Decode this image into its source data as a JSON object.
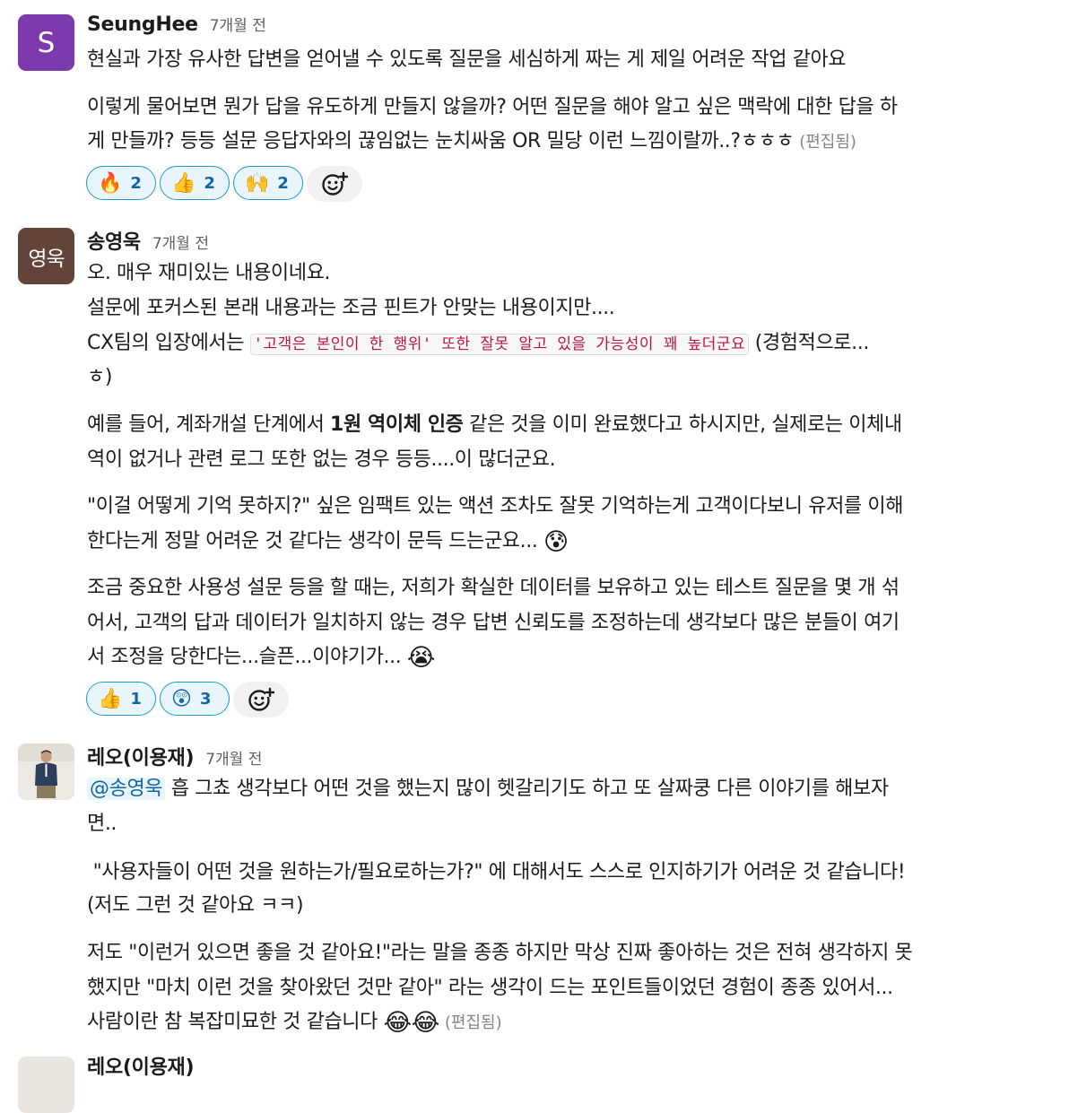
{
  "messages": [
    {
      "author": "SeungHee",
      "avatar_text": "S",
      "time": "7개월 전",
      "lines": [
        "현실과 가장 유사한 답변을 얻어낼 수 있도록 질문을 세심하게 짜는 게 제일 어려운 작업 같아요",
        "이렇게 물어보면 뭔가 답을 유도하게 만들지 않을까? 어떤 질문을 해야 알고 싶은 맥락에 대한 답을 하",
        "게 만들까? 등등 설문 응답자와의 끊임없는 눈치싸움 OR 밀당 이런 느낌이랄까..?ㅎㅎㅎ"
      ],
      "edited": "(편집됨)",
      "reactions": [
        {
          "emoji": "🔥",
          "count": "2"
        },
        {
          "emoji": "👍",
          "count": "2"
        },
        {
          "emoji": "🙌",
          "count": "2"
        }
      ]
    },
    {
      "author": "송영욱",
      "avatar_text": "영욱",
      "time": "7개월 전",
      "lines": {
        "l1": "오. 매우 재미있는 내용이네요.",
        "l2": "설문에 포커스된 본래 내용과는 조금 핀트가 안맞는 내용이지만....",
        "l3_pre": "CX팀의 입장에서는 ",
        "l3_code": "'고객은 본인이 한 행위' 또한 잘못 알고 있을 가능성이 꽤 높더군요",
        "l3_post": " (경험적으로...",
        "l4": "ㅎ)",
        "l5_pre": "예를 들어, 계좌개설 단계에서 ",
        "l5_bold": "1원 역이체 인증",
        "l5_post": " 같은 것을 이미 완료했다고 하시지만, 실제로는 이체내",
        "l6": "역이 없거나 관련 로그 또한 없는 경우 등등....이 많더군요.",
        "l7": "\"이걸 어떻게 기억 못하지?\" 싶은 임팩트 있는 액션 조차도 잘못 기억하는게 고객이다보니 유저를 이해",
        "l8": "한다는게 정말 어려운 것 같다는 생각이 문득 드는군요...",
        "l8_emoji": "😰",
        "l9": "조금 중요한 사용성 설문 등을 할 때는, 저희가 확실한 데이터를 보유하고 있는 테스트 질문을 몇 개 섞",
        "l10": "어서, 고객의 답과 데이터가 일치하지 않는 경우 답변 신뢰도를 조정하는데 생각보다 많은 분들이 여기",
        "l11": "서 조정을 당한다는...슬픈...이야기가...",
        "l11_emoji": "😭"
      },
      "reactions": [
        {
          "emoji": "👍",
          "count": "1"
        },
        {
          "emoji": "😲",
          "count": "3"
        }
      ]
    },
    {
      "author": "레오(이용재)",
      "time": "7개월 전",
      "lines": {
        "l1_mention": "@송영욱",
        "l1_post": " 흡 그쵸 생각보다 어떤 것을 했는지 많이 헷갈리기도 하고 또 살짜쿵 다른 이야기를 해보자",
        "l2": "면..",
        "l3": " \"사용자들이 어떤 것을 원하는가/필요로하는가?\" 에 대해서도 스스로 인지하기가 어려운 것 같습니다!",
        "l4": "(저도 그런 것 같아요 ㅋㅋ)",
        "l5": "저도 \"이런거 있으면 좋을 것 같아요!\"라는 말을 종종 하지만 막상 진짜 좋아하는 것은 전혀 생각하지 못",
        "l6": "했지만 \"마치 이런 것을 찾아왔던 것만 같아\" 라는 생각이 드는 포인트들이었던 경험이 종종 있어서...",
        "l7": "사람이란 참 복잡미묘한 것 같습니다 ",
        "l7_emoji": "😂😂",
        "edited": "(편집됨)"
      }
    },
    {
      "author": "레오(이용재)"
    }
  ],
  "icons": {
    "add_reaction": "add-reaction-icon"
  },
  "colors": {
    "mention": "#1264a3",
    "code": "#c01343",
    "reaction_border": "#1d9bd1"
  }
}
